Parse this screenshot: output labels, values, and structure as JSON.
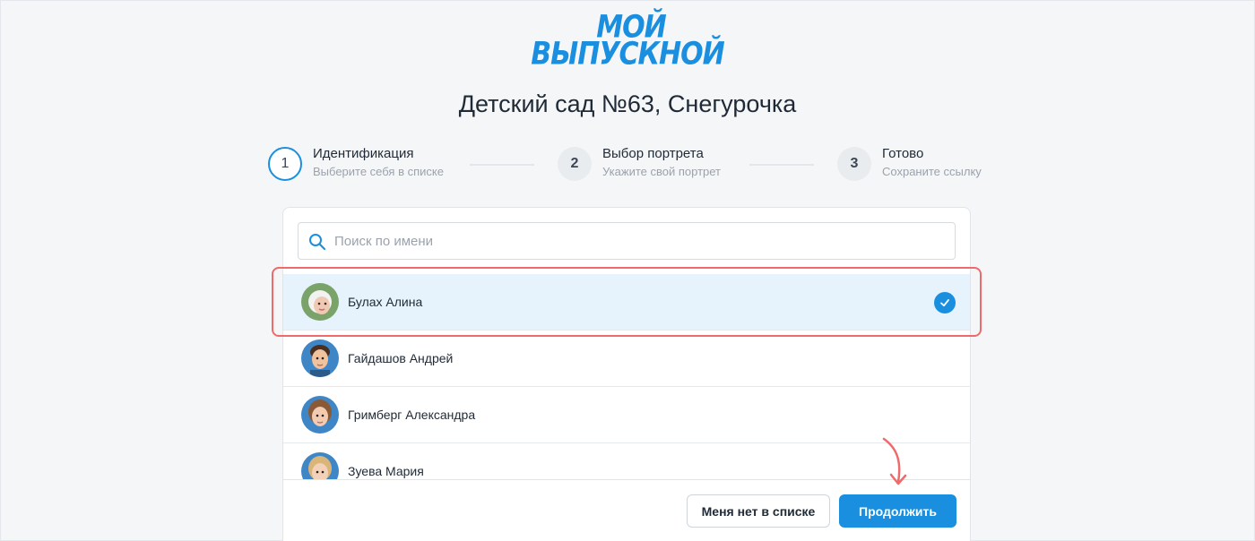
{
  "brand": {
    "logo_line1": "МОЙ",
    "logo_line2": "ВЫПУСКНОЙ",
    "color": "#1a8fe0"
  },
  "page": {
    "title": "Детский сад №63, Снегурочка"
  },
  "stepper": {
    "steps": [
      {
        "number": "1",
        "title": "Идентификация",
        "subtitle": "Выберите себя в списке",
        "state": "active"
      },
      {
        "number": "2",
        "title": "Выбор портрета",
        "subtitle": "Укажите свой портрет",
        "state": "pending"
      },
      {
        "number": "3",
        "title": "Готово",
        "subtitle": "Сохраните ссылку",
        "state": "pending"
      }
    ]
  },
  "search": {
    "placeholder": "Поиск по имени",
    "value": "",
    "icon": "search-icon"
  },
  "students": [
    {
      "name": "Булах Алина",
      "selected": true
    },
    {
      "name": "Гайдашов Андрей",
      "selected": false
    },
    {
      "name": "Гримберг Александра",
      "selected": false
    },
    {
      "name": "Зуева Мария",
      "selected": false
    }
  ],
  "actions": {
    "not_in_list_label": "Меня нет в списке",
    "continue_label": "Продолжить"
  },
  "colors": {
    "accent": "#1a8fe0",
    "selected_row": "#e6f2fc",
    "annotation": "#ef6a6a"
  }
}
